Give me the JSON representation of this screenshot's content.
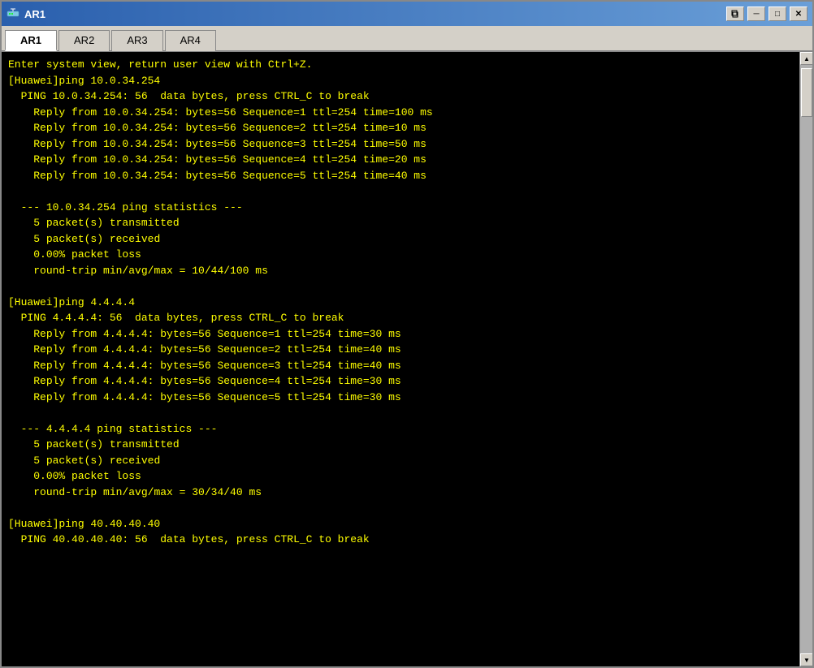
{
  "window": {
    "title": "AR1",
    "icon": "router-icon",
    "buttons": {
      "minimize": "─",
      "restore": "□",
      "maximize": "□",
      "close": "✕"
    }
  },
  "tabs": [
    {
      "label": "AR1",
      "active": true
    },
    {
      "label": "AR2",
      "active": false
    },
    {
      "label": "AR3",
      "active": false
    },
    {
      "label": "AR4",
      "active": false
    }
  ],
  "terminal": {
    "content": "Enter system view, return user view with Ctrl+Z.\n[Huawei]ping 10.0.34.254\n  PING 10.0.34.254: 56  data bytes, press CTRL_C to break\n    Reply from 10.0.34.254: bytes=56 Sequence=1 ttl=254 time=100 ms\n    Reply from 10.0.34.254: bytes=56 Sequence=2 ttl=254 time=10 ms\n    Reply from 10.0.34.254: bytes=56 Sequence=3 ttl=254 time=50 ms\n    Reply from 10.0.34.254: bytes=56 Sequence=4 ttl=254 time=20 ms\n    Reply from 10.0.34.254: bytes=56 Sequence=5 ttl=254 time=40 ms\n\n  --- 10.0.34.254 ping statistics ---\n    5 packet(s) transmitted\n    5 packet(s) received\n    0.00% packet loss\n    round-trip min/avg/max = 10/44/100 ms\n\n[Huawei]ping 4.4.4.4\n  PING 4.4.4.4: 56  data bytes, press CTRL_C to break\n    Reply from 4.4.4.4: bytes=56 Sequence=1 ttl=254 time=30 ms\n    Reply from 4.4.4.4: bytes=56 Sequence=2 ttl=254 time=40 ms\n    Reply from 4.4.4.4: bytes=56 Sequence=3 ttl=254 time=40 ms\n    Reply from 4.4.4.4: bytes=56 Sequence=4 ttl=254 time=30 ms\n    Reply from 4.4.4.4: bytes=56 Sequence=5 ttl=254 time=30 ms\n\n  --- 4.4.4.4 ping statistics ---\n    5 packet(s) transmitted\n    5 packet(s) received\n    0.00% packet loss\n    round-trip min/avg/max = 30/34/40 ms\n\n[Huawei]ping 40.40.40.40\n  PING 40.40.40.40: 56  data bytes, press CTRL_C to break"
  }
}
